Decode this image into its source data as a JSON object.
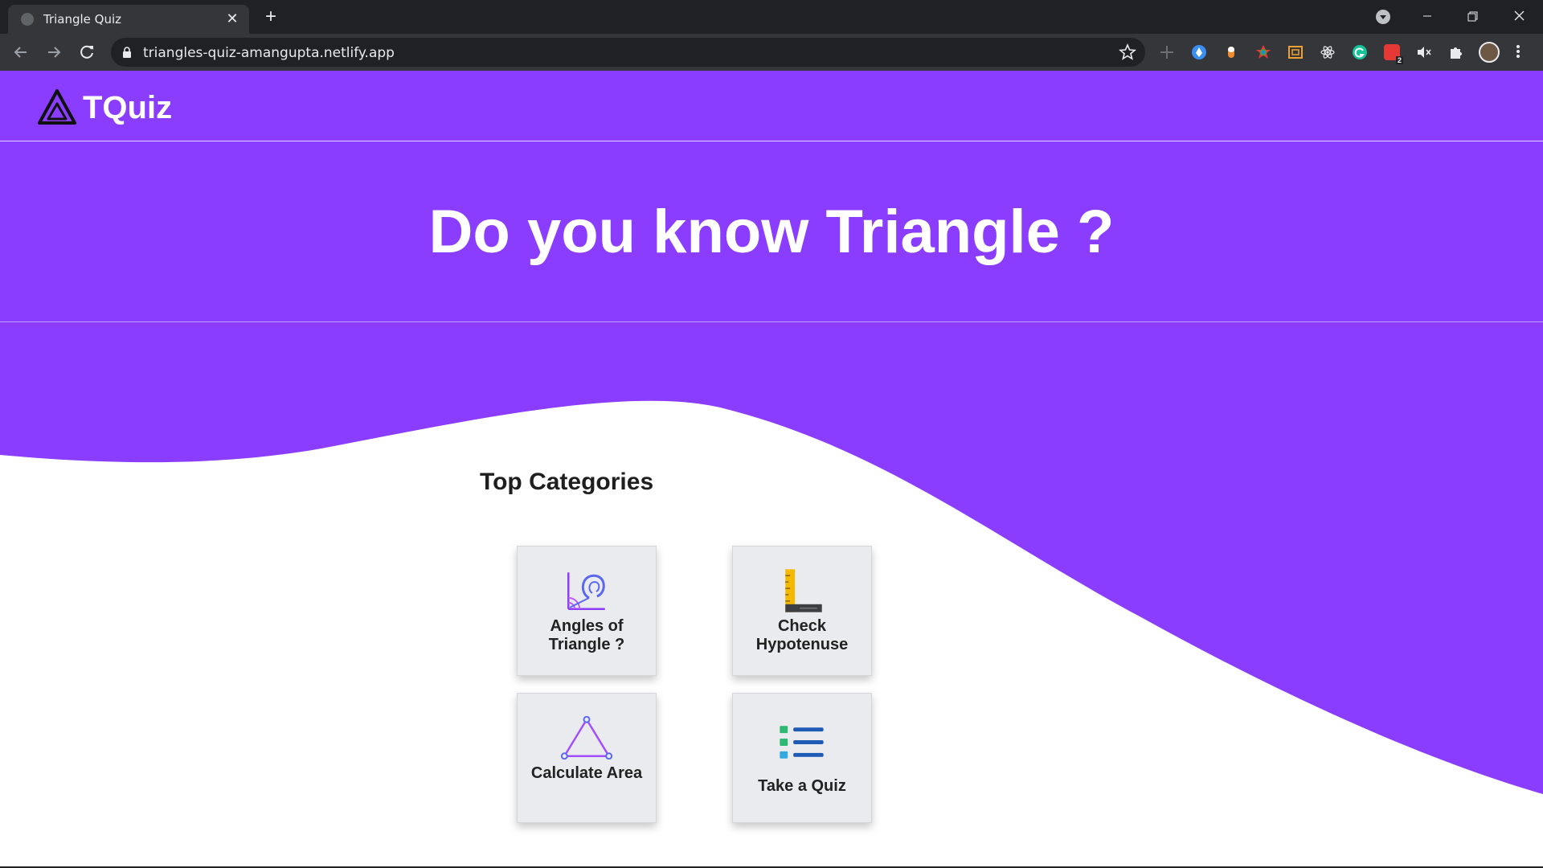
{
  "browser": {
    "tab_title": "Triangle Quiz",
    "url": "triangles-quiz-amangupta.netlify.app",
    "extension_badge": "2"
  },
  "app": {
    "brand": "TQuiz",
    "accent_color": "#8a3cff",
    "hero_title": "Do you know Triangle ?",
    "section_title": "Top Categories",
    "categories": [
      {
        "label": "Angles of Triangle ?",
        "icon": "protractor-angle-icon"
      },
      {
        "label": "Check Hypotenuse",
        "icon": "set-square-ruler-icon"
      },
      {
        "label": "Calculate Area",
        "icon": "triangle-vertices-icon"
      },
      {
        "label": "Take a Quiz",
        "icon": "checklist-icon"
      }
    ]
  }
}
